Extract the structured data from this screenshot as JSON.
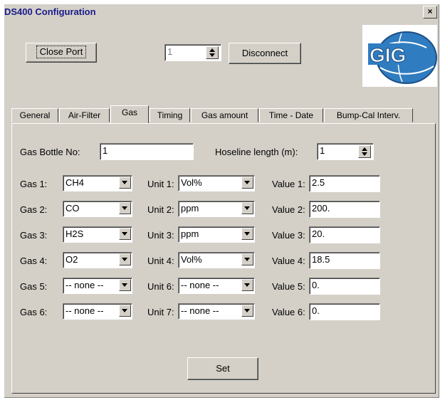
{
  "window": {
    "title": "DS400 Configuration",
    "close_glyph": "×"
  },
  "toolbar": {
    "close_port_label": "Close Port",
    "port_value": "1",
    "disconnect_label": "Disconnect"
  },
  "logo": {
    "text": "GIG",
    "icon": "globe-logo-icon"
  },
  "tabs": [
    {
      "label": "General",
      "active": false
    },
    {
      "label": "Air-Filter",
      "active": false
    },
    {
      "label": "Gas",
      "active": true
    },
    {
      "label": "Timing",
      "active": false
    },
    {
      "label": "Gas amount",
      "active": false
    },
    {
      "label": "Time - Date",
      "active": false
    },
    {
      "label": "Bump-Cal Interv.",
      "active": false
    }
  ],
  "gas_tab": {
    "bottle_label": "Gas Bottle No:",
    "bottle_value": "1",
    "hoseline_label": "Hoseline length (m):",
    "hoseline_value": "1",
    "rows": [
      {
        "gas_label": "Gas 1:",
        "gas": "CH4",
        "unit_label": "Unit 1:",
        "unit": "Vol%",
        "value_label": "Value 1:",
        "value": "2.5"
      },
      {
        "gas_label": "Gas 2:",
        "gas": "CO",
        "unit_label": "Unit 2:",
        "unit": "ppm",
        "value_label": "Value 2:",
        "value": "200."
      },
      {
        "gas_label": "Gas 3:",
        "gas": "H2S",
        "unit_label": "Unit 3:",
        "unit": "ppm",
        "value_label": "Value 3:",
        "value": "20."
      },
      {
        "gas_label": "Gas 4:",
        "gas": "O2",
        "unit_label": "Unit 4:",
        "unit": "Vol%",
        "value_label": "Value 4:",
        "value": "18.5"
      },
      {
        "gas_label": "Gas 5:",
        "gas": "-- none --",
        "unit_label": "Unit 6:",
        "unit": "-- none --",
        "value_label": "Value 5:",
        "value": "0."
      },
      {
        "gas_label": "Gas 6:",
        "gas": "-- none --",
        "unit_label": "Unit 7:",
        "unit": "-- none --",
        "value_label": "Value 6:",
        "value": "0."
      }
    ],
    "set_label": "Set"
  }
}
